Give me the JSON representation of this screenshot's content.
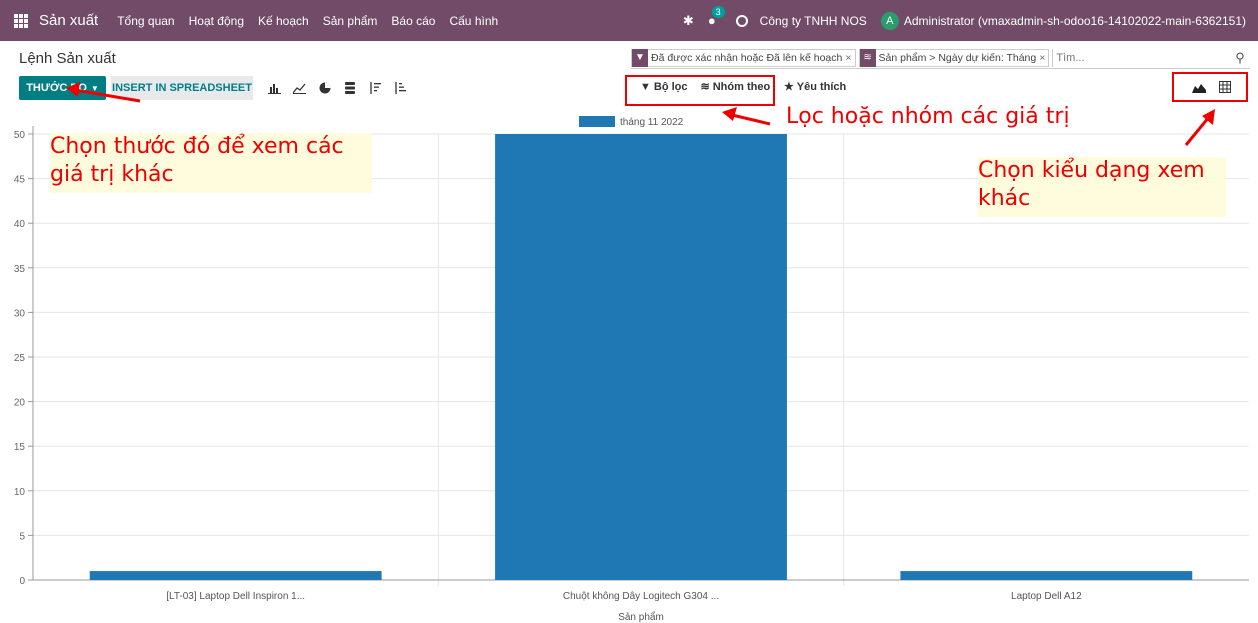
{
  "topbar": {
    "app_name": "Sản xuất",
    "menu": [
      "Tổng quan",
      "Hoạt động",
      "Kế hoạch",
      "Sản phẩm",
      "Báo cáo",
      "Cấu hình"
    ],
    "chat_count": "3",
    "company": "Công ty TNHH NOS",
    "avatar_letter": "A",
    "user": "Administrator (vmaxadmin-sh-odoo16-14102022-main-6362151)"
  },
  "breadcrumb": "Lệnh Sản xuất",
  "search": {
    "facet_filter": "Đã được xác nhận hoặc Đã lên kế hoạch",
    "facet_group": "Sản phẩm > Ngày dự kiến: Tháng",
    "placeholder": "Tìm..."
  },
  "toolbar": {
    "measure_label": "THƯỚC ĐO",
    "spreadsheet_label": "INSERT IN SPREADSHEET",
    "filters_label": "Bộ lọc",
    "groupby_label": "Nhóm theo",
    "favorites_label": "Yêu thích"
  },
  "annotations": {
    "measure_note": "Chọn thước đó để xem các giá trị khác",
    "filter_note": "Lọc hoặc nhóm các giá trị",
    "view_note": "Chọn kiểu dạng xem khác"
  },
  "colors": {
    "topbar": "#714b67",
    "primary_button": "#017e84",
    "bar": "#1f77b4",
    "annotation": "#ee0000"
  },
  "chart_data": {
    "type": "bar",
    "categories": [
      "[LT-03] Laptop Dell Inspiron 1...",
      "Chuột không Dây Logitech G304 ...",
      "Laptop Dell A12"
    ],
    "series": [
      {
        "name": "tháng 11 2022",
        "values": [
          1,
          50,
          1
        ]
      }
    ],
    "xlabel": "Sản phẩm",
    "ylabel": "",
    "ylim": [
      0,
      50
    ],
    "yticks": [
      0,
      5,
      10,
      15,
      20,
      25,
      30,
      35,
      40,
      45,
      50
    ],
    "grid": true,
    "legend": "top-center"
  }
}
